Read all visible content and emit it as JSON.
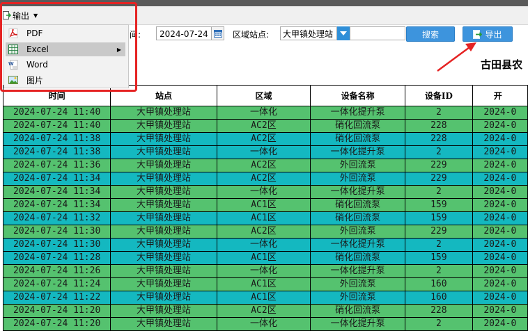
{
  "toolbar": {
    "export_menu_label": "输出"
  },
  "filters": {
    "date_label": "间:",
    "date_value": "2024-07-24",
    "site_label": "区域站点:",
    "site_value": "大甲镇处理站",
    "search_label": "搜索",
    "export_label": "导出"
  },
  "report_title": "古田县农",
  "menu": {
    "items": [
      {
        "label": "PDF",
        "icon": "pdf-icon"
      },
      {
        "label": "Excel",
        "icon": "excel-icon"
      },
      {
        "label": "Word",
        "icon": "word-icon"
      },
      {
        "label": "图片",
        "icon": "image-icon"
      }
    ]
  },
  "table": {
    "headers": [
      "时间",
      "站点",
      "区域",
      "设备名称",
      "设备ID",
      "开"
    ],
    "rows": [
      {
        "time": "2024-07-24 11:40",
        "site": "大甲镇处理站",
        "area": "一体化",
        "device": "一体化提升泵",
        "id": "2",
        "open": "2024-0",
        "color": "green"
      },
      {
        "time": "2024-07-24 11:40",
        "site": "大甲镇处理站",
        "area": "AC2区",
        "device": "硝化回流泵",
        "id": "228",
        "open": "2024-0",
        "color": "green"
      },
      {
        "time": "2024-07-24 11:38",
        "site": "大甲镇处理站",
        "area": "AC2区",
        "device": "硝化回流泵",
        "id": "228",
        "open": "2024-0",
        "color": "cyan"
      },
      {
        "time": "2024-07-24 11:38",
        "site": "大甲镇处理站",
        "area": "一体化",
        "device": "一体化提升泵",
        "id": "2",
        "open": "2024-0",
        "color": "cyan"
      },
      {
        "time": "2024-07-24 11:36",
        "site": "大甲镇处理站",
        "area": "AC2区",
        "device": "外回流泵",
        "id": "229",
        "open": "2024-0",
        "color": "green"
      },
      {
        "time": "2024-07-24 11:34",
        "site": "大甲镇处理站",
        "area": "AC2区",
        "device": "外回流泵",
        "id": "229",
        "open": "2024-0",
        "color": "cyan"
      },
      {
        "time": "2024-07-24 11:34",
        "site": "大甲镇处理站",
        "area": "一体化",
        "device": "一体化提升泵",
        "id": "2",
        "open": "2024-0",
        "color": "green"
      },
      {
        "time": "2024-07-24 11:34",
        "site": "大甲镇处理站",
        "area": "AC1区",
        "device": "硝化回流泵",
        "id": "159",
        "open": "2024-0",
        "color": "green"
      },
      {
        "time": "2024-07-24 11:32",
        "site": "大甲镇处理站",
        "area": "AC1区",
        "device": "硝化回流泵",
        "id": "159",
        "open": "2024-0",
        "color": "cyan"
      },
      {
        "time": "2024-07-24 11:30",
        "site": "大甲镇处理站",
        "area": "AC2区",
        "device": "外回流泵",
        "id": "229",
        "open": "2024-0",
        "color": "green"
      },
      {
        "time": "2024-07-24 11:30",
        "site": "大甲镇处理站",
        "area": "一体化",
        "device": "一体化提升泵",
        "id": "2",
        "open": "2024-0",
        "color": "cyan"
      },
      {
        "time": "2024-07-24 11:28",
        "site": "大甲镇处理站",
        "area": "AC1区",
        "device": "硝化回流泵",
        "id": "159",
        "open": "2024-0",
        "color": "cyan"
      },
      {
        "time": "2024-07-24 11:26",
        "site": "大甲镇处理站",
        "area": "一体化",
        "device": "一体化提升泵",
        "id": "2",
        "open": "2024-0",
        "color": "green"
      },
      {
        "time": "2024-07-24 11:24",
        "site": "大甲镇处理站",
        "area": "AC1区",
        "device": "外回流泵",
        "id": "160",
        "open": "2024-0",
        "color": "green"
      },
      {
        "time": "2024-07-24 11:22",
        "site": "大甲镇处理站",
        "area": "AC1区",
        "device": "外回流泵",
        "id": "160",
        "open": "2024-0",
        "color": "cyan"
      },
      {
        "time": "2024-07-24 11:20",
        "site": "大甲镇处理站",
        "area": "AC2区",
        "device": "硝化回流泵",
        "id": "228",
        "open": "2024-0",
        "color": "green"
      },
      {
        "time": "2024-07-24 11:20",
        "site": "大甲镇处理站",
        "area": "一体化",
        "device": "一体化提升泵",
        "id": "2",
        "open": "2024-0",
        "color": "green"
      }
    ]
  },
  "colors": {
    "row_green": "#55c26f",
    "row_cyan": "#14b8c0",
    "highlight": "#e52323",
    "button_blue": "#3d94dd"
  }
}
